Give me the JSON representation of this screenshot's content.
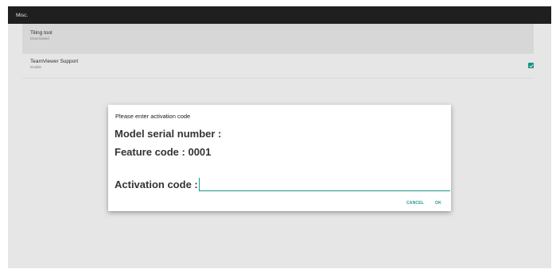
{
  "window": {
    "title": "Misc."
  },
  "settings": [
    {
      "title": "Tiling tool",
      "subtitle": "Deactivated"
    },
    {
      "title": "TeamViewer Support",
      "subtitle": "Enable",
      "checked": true
    }
  ],
  "dialog": {
    "title": "Please enter activation code",
    "model_serial_label": "Model serial number :",
    "feature_code_label": "Feature code : 0001",
    "activation_label": "Activation code :",
    "activation_value": "",
    "cancel_label": "CANCEL",
    "ok_label": "OK"
  },
  "colors": {
    "accent": "#199a8f",
    "titlebar": "#1f1f1f",
    "background": "#f3f3f3"
  },
  "icons": {
    "checkbox": "checkmark-icon"
  }
}
